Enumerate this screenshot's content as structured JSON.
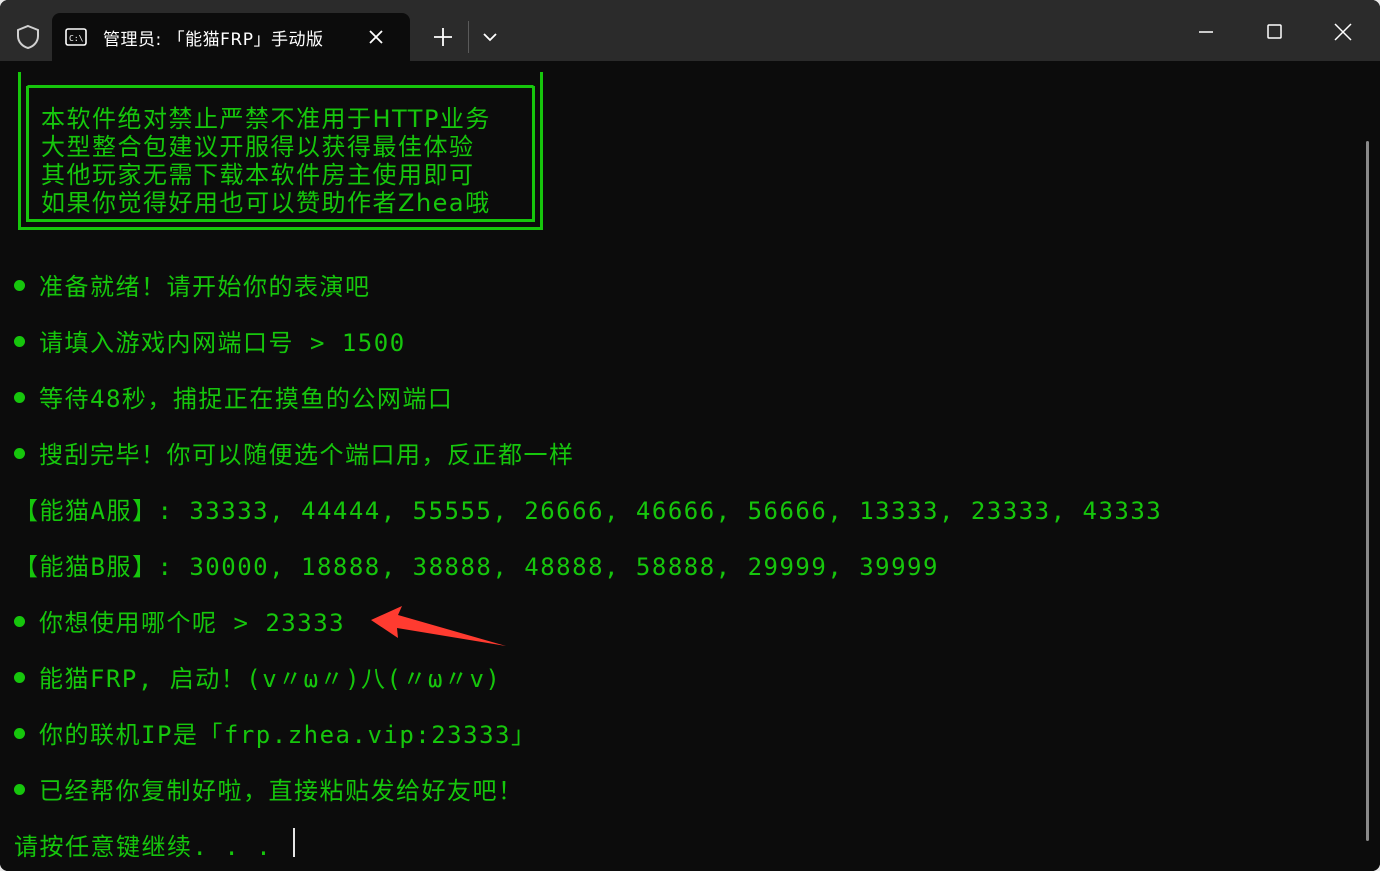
{
  "window": {
    "tab_title": "管理员: 「能猫FRP」手动版"
  },
  "icons": {
    "shield": "shield-icon",
    "terminal": "terminal-icon",
    "close": "close-icon",
    "plus": "plus-icon",
    "chevron": "chevron-down-icon",
    "minimize": "minimize-icon",
    "maximize": "maximize-icon"
  },
  "banner": {
    "lines": [
      "本软件绝对禁止严禁不准用于HTTP业务",
      "大型整合包建议开服得以获得最佳体验",
      "其他玩家无需下载本软件房主使用即可",
      "如果你觉得好用也可以赞助作者Zhea哦"
    ]
  },
  "output": {
    "lines": [
      "准备就绪！请开始你的表演吧",
      "请填入游戏内网端口号 > 1500",
      "等待48秒，捕捉正在摸鱼的公网端口",
      "搜刮完毕！你可以随便选个端口用，反正都一样",
      "【能猫A服】: 33333, 44444, 55555, 26666, 46666, 56666, 13333, 23333, 43333",
      "【能猫B服】: 30000, 18888, 38888, 48888, 58888, 29999, 39999",
      "你想使用哪个呢 > 23333",
      "能猫FRP, 启动！(v〃ω〃)八(〃ω〃v)",
      "你的联机IP是「frp.zhea.vip:23333」",
      "已经帮你复制好啦，直接粘贴发给好友吧！",
      "请按任意键继续. . ."
    ]
  },
  "colors": {
    "terminal_bg": "#0c0c0c",
    "text_green": "#16c60c",
    "titlebar_bg": "#2b2b2b",
    "annotation_arrow": "#ff3b30"
  }
}
